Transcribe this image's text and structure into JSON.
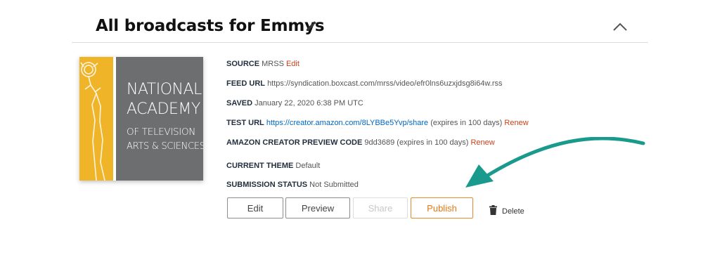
{
  "header": {
    "title": "All broadcasts for Emmys",
    "edit_icon": "pencil-icon",
    "collapse_icon": "chevron-up-icon"
  },
  "thumbnail": {
    "line1": "NATIONAL",
    "line2": "ACADEMY",
    "line3": "OF TELEVISION",
    "line4": "ARTS & SCIENCES",
    "colors": {
      "gold": "#f0b429",
      "grey": "#6d6e70"
    }
  },
  "details": {
    "source": {
      "label": "SOURCE",
      "value": "MRSS",
      "action": "Edit"
    },
    "feed_url": {
      "label": "FEED URL",
      "value": "https://syndication.boxcast.com/mrss/video/efr0lns6uzxjdsg8i64w.rss"
    },
    "saved": {
      "label": "SAVED",
      "value": "January 22, 2020 6:38 PM UTC"
    },
    "test_url": {
      "label": "TEST URL",
      "link": "https://creator.amazon.com/8LYBBe5Yvp/share",
      "note": "(expires in 100 days)",
      "action": "Renew"
    },
    "preview_code": {
      "label": "AMAZON CREATOR PREVIEW CODE",
      "value": "9dd3689",
      "note": "(expires in 100 days)",
      "action": "Renew"
    },
    "theme": {
      "label": "CURRENT THEME",
      "value": "Default"
    },
    "status": {
      "label": "SUBMISSION STATUS",
      "value": "Not Submitted"
    }
  },
  "buttons": {
    "edit": "Edit",
    "preview": "Preview",
    "share": "Share",
    "publish": "Publish",
    "delete": "Delete"
  },
  "colors": {
    "link_red": "#c7421e",
    "link_blue": "#0066c0",
    "publish_orange": "#e47911",
    "arrow_teal": "#1a9a8c"
  }
}
